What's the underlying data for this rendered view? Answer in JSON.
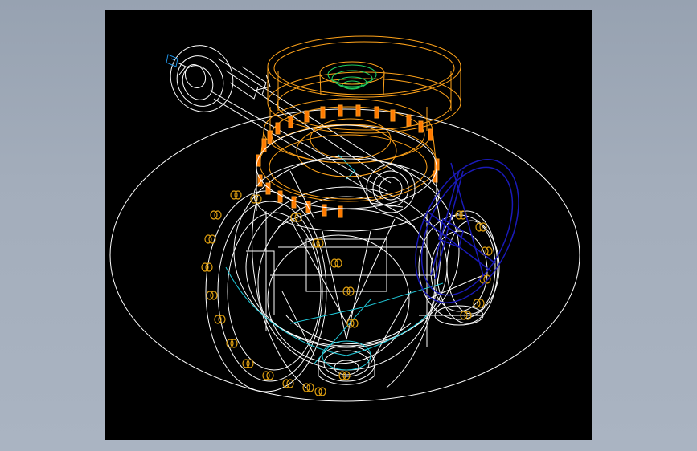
{
  "viewer": {
    "background": "#000000",
    "frame_background": "#a3adbb"
  },
  "drawing": {
    "subject": "valve-wireframe",
    "colors": {
      "base_lines": "#ffffff",
      "actuator": "#ffa31a",
      "actuator_highlight": "#ff7a00",
      "handwheel": "#1a1ab8",
      "flange_bolts": "#e0a010",
      "internal": "#20c8d8",
      "top_cap": "#20d060"
    }
  }
}
